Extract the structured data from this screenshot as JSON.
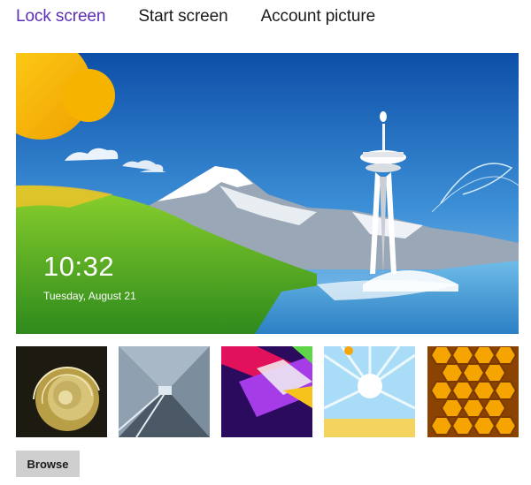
{
  "tabs": [
    {
      "label": "Lock screen",
      "active": true
    },
    {
      "label": "Start screen",
      "active": false
    },
    {
      "label": "Account picture",
      "active": false
    }
  ],
  "preview": {
    "time": "10:32",
    "date": "Tuesday, August 21"
  },
  "thumbnails": [
    {
      "name": "nautilus-shell"
    },
    {
      "name": "train-tunnel"
    },
    {
      "name": "geometric-ribbons"
    },
    {
      "name": "sunburst-sky"
    },
    {
      "name": "honeycomb"
    }
  ],
  "browse_label": "Browse",
  "colors": {
    "accent": "#5b2fb5",
    "button_bg": "#cfcfcf"
  }
}
